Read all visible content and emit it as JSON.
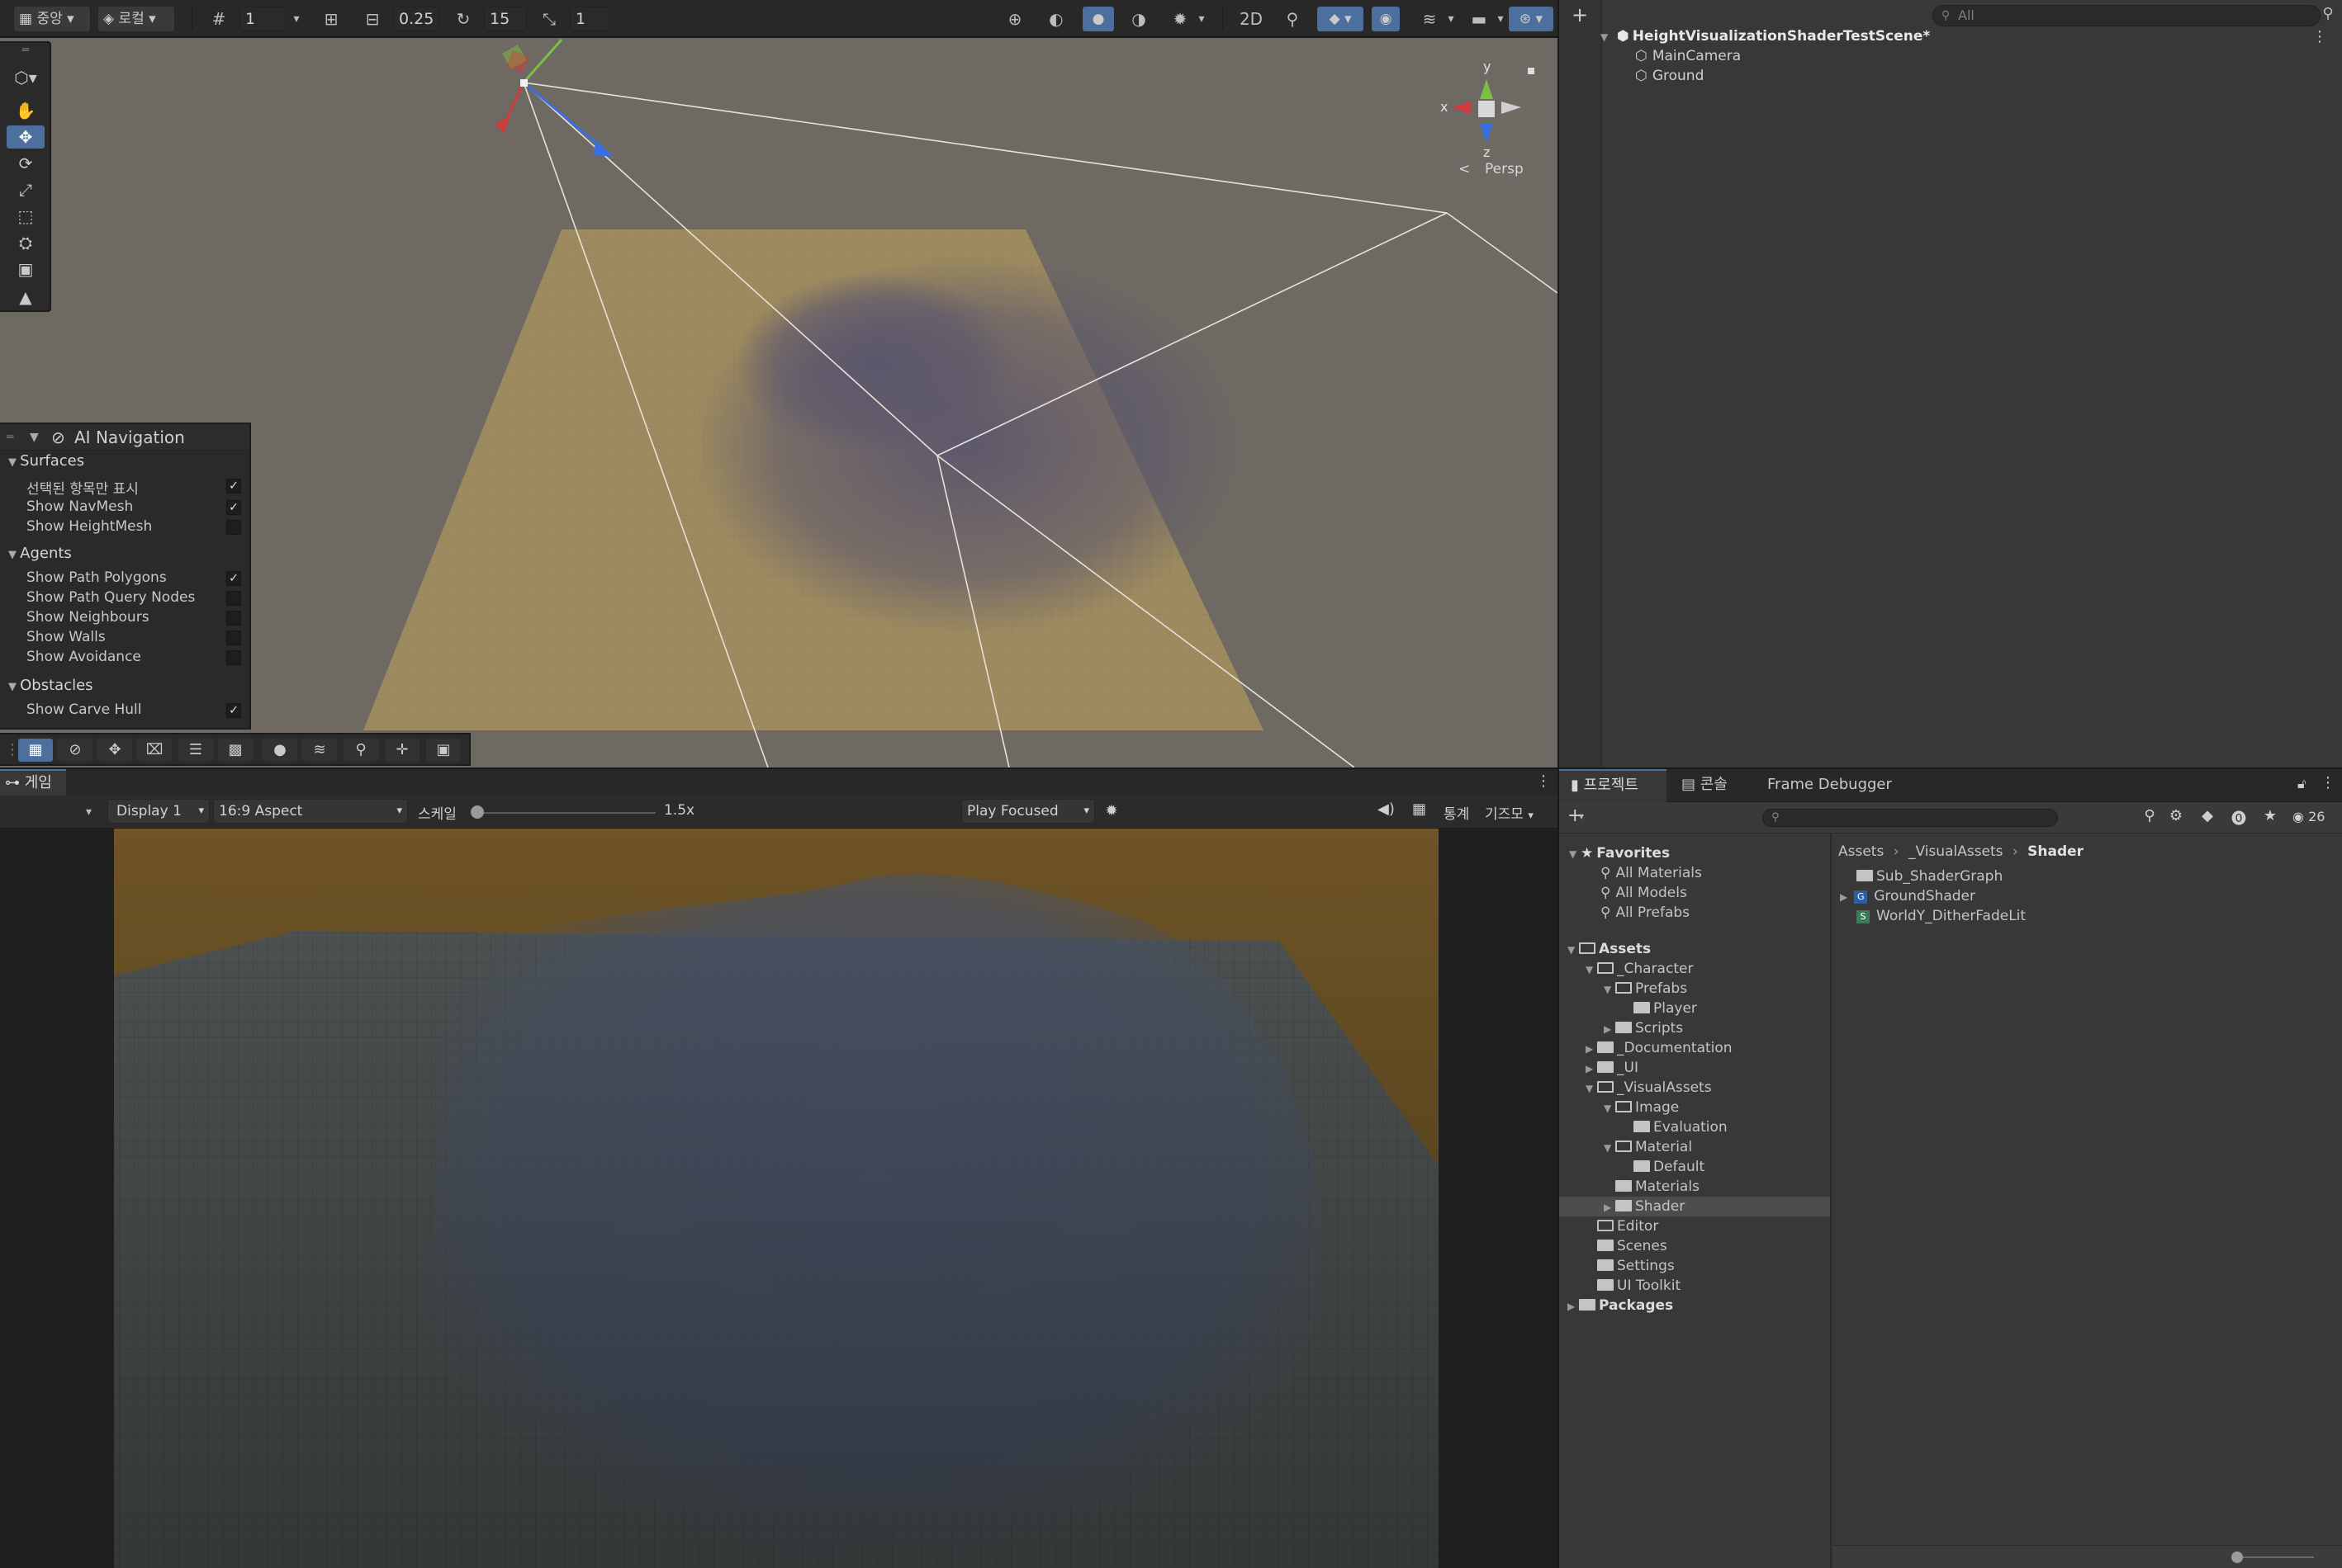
{
  "scene_toolbar": {
    "pivot_label": "중앙",
    "space_label": "로컬",
    "grid_snap_value": "1",
    "increment_snap_value": "0.25",
    "rotate_snap_value": "15",
    "scale_snap_value": "1"
  },
  "scene": {
    "orientation": {
      "x": "x",
      "y": "y",
      "z": "z",
      "persp_label": "Persp"
    }
  },
  "ai_navigation": {
    "title": "AI Navigation",
    "groups": [
      {
        "label": "Surfaces",
        "rows": [
          {
            "label": "선택된 항목만 표시",
            "checked": true
          },
          {
            "label": "Show NavMesh",
            "checked": true
          },
          {
            "label": "Show HeightMesh",
            "checked": false
          }
        ]
      },
      {
        "label": "Agents",
        "rows": [
          {
            "label": "Show Path Polygons",
            "checked": true
          },
          {
            "label": "Show Path Query Nodes",
            "checked": false
          },
          {
            "label": "Show Neighbours",
            "checked": false
          },
          {
            "label": "Show Walls",
            "checked": false
          },
          {
            "label": "Show Avoidance",
            "checked": false
          }
        ]
      },
      {
        "label": "Obstacles",
        "rows": [
          {
            "label": "Show Carve Hull",
            "checked": true
          }
        ]
      }
    ]
  },
  "hierarchy": {
    "search_placeholder": "All",
    "scene_name": "HeightVisualizationShaderTestScene*",
    "items": [
      "MainCamera",
      "Ground"
    ]
  },
  "game": {
    "tab_label": "게임",
    "display": "Display 1",
    "aspect": "16:9 Aspect",
    "scale_label": "스케일",
    "scale_value": "1.5x",
    "play_mode": "Play Focused",
    "stats_label": "통계",
    "gizmos_label": "기즈모"
  },
  "project": {
    "tabs": [
      "프로젝트",
      "콘솔",
      "Frame Debugger"
    ],
    "visible_count": "26",
    "favorites_label": "Favorites",
    "favorites": [
      "All Materials",
      "All Models",
      "All Prefabs"
    ],
    "breadcrumb": [
      "Assets",
      "_VisualAssets",
      "Shader"
    ],
    "tree": [
      {
        "label": "Assets",
        "level": 0,
        "arrow": "open",
        "folder": "open",
        "bold": true
      },
      {
        "label": "_Character",
        "level": 1,
        "arrow": "open",
        "folder": "open"
      },
      {
        "label": "Prefabs",
        "level": 2,
        "arrow": "open",
        "folder": "open"
      },
      {
        "label": "Player",
        "level": 3,
        "arrow": "none",
        "folder": "closed"
      },
      {
        "label": "Scripts",
        "level": 2,
        "arrow": "closed",
        "folder": "closed"
      },
      {
        "label": "_Documentation",
        "level": 1,
        "arrow": "closed",
        "folder": "closed"
      },
      {
        "label": "_UI",
        "level": 1,
        "arrow": "closed",
        "folder": "closed"
      },
      {
        "label": "_VisualAssets",
        "level": 1,
        "arrow": "open",
        "folder": "open"
      },
      {
        "label": "Image",
        "level": 2,
        "arrow": "open",
        "folder": "open"
      },
      {
        "label": "Evaluation",
        "level": 3,
        "arrow": "none",
        "folder": "closed"
      },
      {
        "label": "Material",
        "level": 2,
        "arrow": "open",
        "folder": "open"
      },
      {
        "label": "Default",
        "level": 3,
        "arrow": "none",
        "folder": "closed"
      },
      {
        "label": "Materials",
        "level": 2,
        "arrow": "none",
        "folder": "closed"
      },
      {
        "label": "Shader",
        "level": 2,
        "arrow": "closed",
        "folder": "closed",
        "selected": true
      },
      {
        "label": "Editor",
        "level": 1,
        "arrow": "none",
        "folder": "empty"
      },
      {
        "label": "Scenes",
        "level": 1,
        "arrow": "none",
        "folder": "closed"
      },
      {
        "label": "Settings",
        "level": 1,
        "arrow": "none",
        "folder": "closed"
      },
      {
        "label": "UI Toolkit",
        "level": 1,
        "arrow": "none",
        "folder": "closed"
      },
      {
        "label": "Packages",
        "level": 0,
        "arrow": "closed",
        "folder": "closed",
        "bold": true
      }
    ],
    "content": [
      {
        "label": "Sub_ShaderGraph",
        "icon": "folder"
      },
      {
        "label": "GroundShader",
        "icon": "shader-graph"
      },
      {
        "label": "WorldY_DitherFadeLit",
        "icon": "shader"
      }
    ]
  },
  "colors": {
    "accent": "#4c6f9d",
    "scene_sky": "#6e6963",
    "ground": "#9d8a5f",
    "game_sky": "#6e5426",
    "axis_x": "#d23b3b",
    "axis_y": "#7ac043",
    "axis_z": "#3a6fe0"
  }
}
